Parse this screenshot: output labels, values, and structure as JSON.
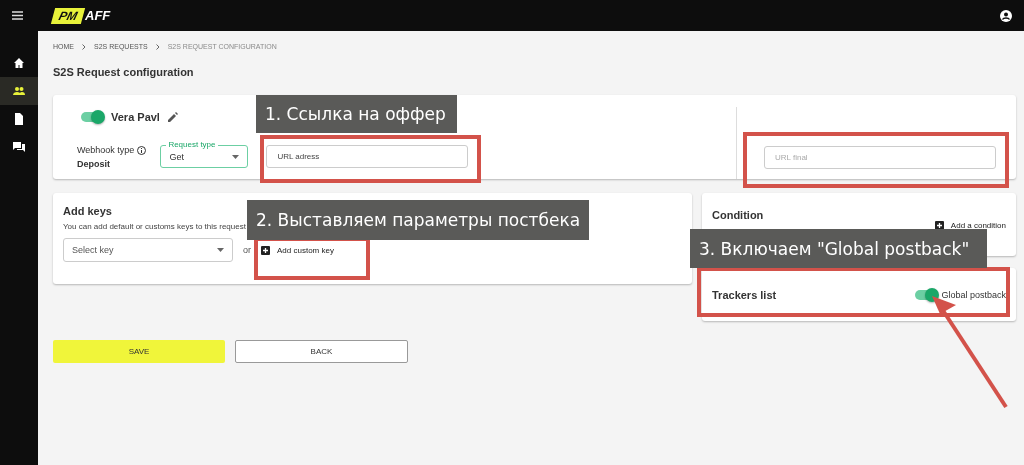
{
  "header": {
    "logo_badge": "PM",
    "logo_text": "AFF"
  },
  "sidebar": {
    "items": [
      {
        "selected": false
      },
      {
        "selected": true
      },
      {
        "selected": false
      },
      {
        "selected": false
      }
    ]
  },
  "breadcrumb": [
    "HOME",
    "S2S REQUESTS",
    "S2S REQUEST CONFIGURATION"
  ],
  "page_title": "S2S Request configuration",
  "request_card": {
    "enabled": true,
    "name": "Vera Pavl",
    "webhook_label": "Webhook type",
    "webhook_value": "Deposit",
    "request_type": {
      "label": "Request type",
      "value": "Get"
    },
    "url": {
      "placeholder": "URL adress"
    },
    "url_final": {
      "placeholder": "URL final"
    }
  },
  "add_keys": {
    "title": "Add keys",
    "description": "You can add default or customs keys to this request",
    "select": {
      "placeholder": "Select key"
    },
    "separator": "or",
    "add_button": "Add custom key"
  },
  "condition": {
    "title": "Condition",
    "add_button": "Add a condition"
  },
  "trackers": {
    "title": "Trackers list",
    "global_postback": {
      "label": "Global postback",
      "on": true
    }
  },
  "buttons": [
    {
      "label": "SAVE",
      "kind": "primary"
    },
    {
      "label": "BACK",
      "kind": "secondary"
    }
  ],
  "annotations": [
    "1. Ссылка на оффер",
    "2. Выставляем параметры постбека",
    "3. Включаем \"Global postback\""
  ]
}
